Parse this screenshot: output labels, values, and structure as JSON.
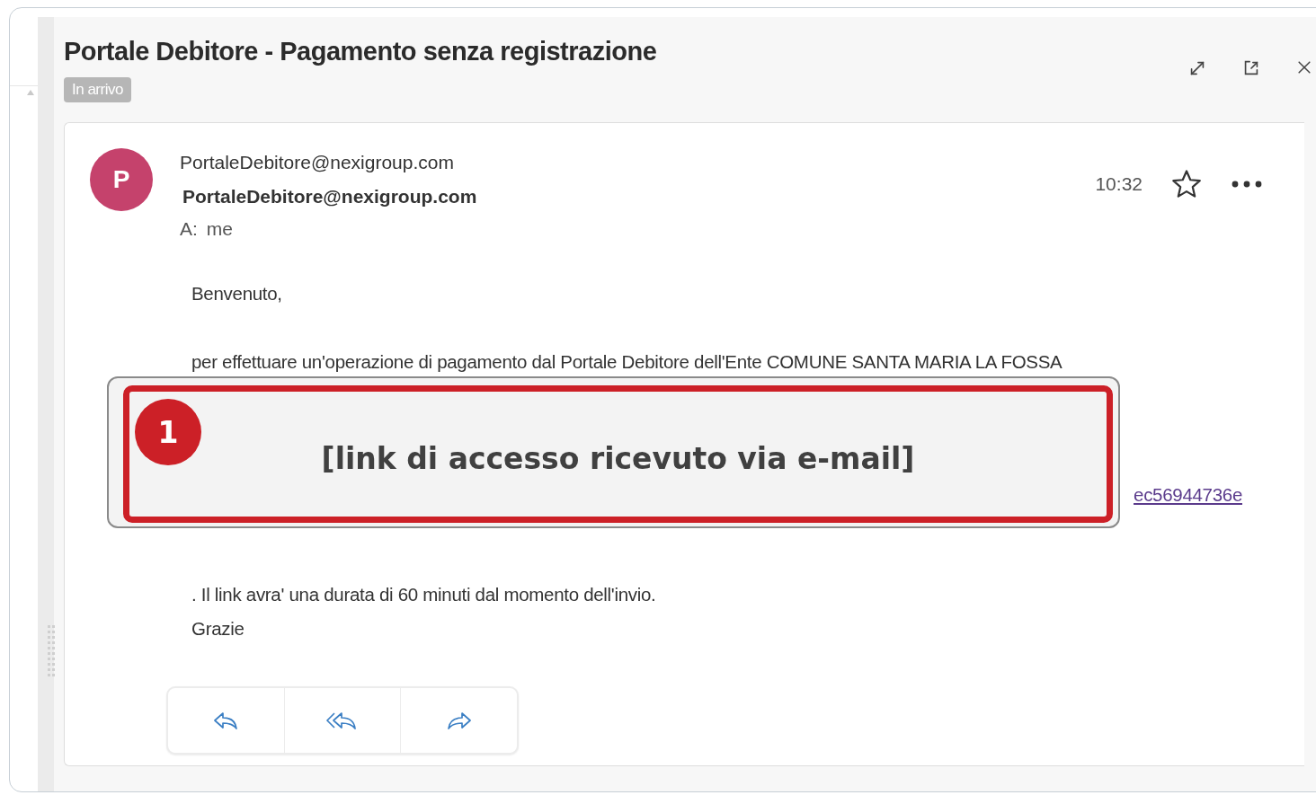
{
  "message": {
    "subject": "Portale Debitore - Pagamento senza registrazione",
    "folder_tag": "In arrivo",
    "sender": {
      "initial": "P",
      "name": "PortaleDebitore@nexigroup.com",
      "address": "PortaleDebitore@nexigroup.com",
      "color": "#c5426c"
    },
    "recipient_label": "A:",
    "recipient": "me",
    "time": "10:32",
    "starred": false,
    "body": [
      {
        "kind": "text",
        "text": "Benvenuto,"
      },
      {
        "kind": "text",
        "text": "per effettuare un'operazione di pagamento dal Portale Debitore dell'Ente COMUNE SANTA MARIA LA FOSSA"
      },
      {
        "kind": "link",
        "text": "ec56944736e"
      },
      {
        "kind": "text",
        "text": ". Il link avra' una durata di 60 minuti dal momento dell'invio."
      },
      {
        "kind": "text",
        "text": "Grazie"
      }
    ]
  },
  "annotation": {
    "number": "1",
    "text": "[link di accesso ricevuto via e-mail]"
  }
}
